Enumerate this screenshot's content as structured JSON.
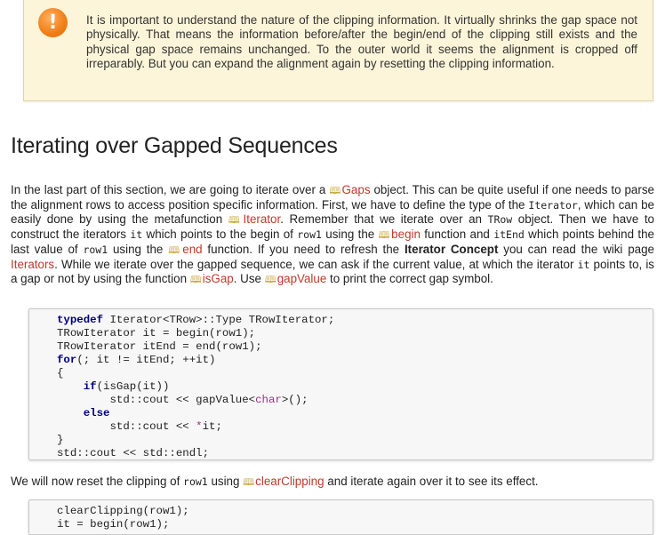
{
  "warning": {
    "icon": "exclamation-icon",
    "icon_glyph": "!",
    "text": "It is important to understand the nature of the clipping information. It virtually shrinks the gap space not physically. That means the information before/after the begin/end of the clipping still exists and the physical gap space remains unchanged. To the outer world it seems the alignment is cropped off irreparably. But you can expand the alignment again by resetting the clipping information."
  },
  "section": {
    "title": "Iterating over Gapped Sequences"
  },
  "para1": {
    "t1": "In the last part of this section, we are going to iterate over a ",
    "link_gaps": "Gaps",
    "t2": " object. This can be quite useful if one needs to parse the alignment rows to access position specific information. First, we have to define the type of the ",
    "code_iterator": "Iterator",
    "t3": ", which can be easily done by using the metafunction ",
    "link_iterator": "Iterator",
    "t4": ". Remember that we iterate over an ",
    "code_trow": "TRow",
    "t5": " object. Then we have to construct the iterators ",
    "code_it": "it",
    "t6": " which points to the begin of ",
    "code_row1": "row1",
    "t7": " using the ",
    "link_begin": "begin",
    "t8": " function and ",
    "code_itend": "itEnd",
    "t9": " which points behind the last value of ",
    "code_row1b": "row1",
    "t10": " using the ",
    "link_end": "end",
    "t11": " function. If you need to refresh the ",
    "bold_concept": "Iterator Concept",
    "t12": " you can read the wiki page ",
    "link_iterators": "Iterators",
    "t13": ". While we iterate over the gapped sequence, we can ask if the current value, at which the iterator ",
    "code_it2": "it",
    "t14": " points to, is a gap or not by using the function ",
    "link_isgap": "isGap",
    "t15": ". Use ",
    "link_gapvalue": "gapValue",
    "t16": " to print the correct gap symbol."
  },
  "code1": {
    "l1_kw": "typedef",
    "l1_rest": " Iterator<TRow>::Type TRowIterator;",
    "l2": "TRowIterator it = begin(row1);",
    "l3": "TRowIterator itEnd = end(row1);",
    "l4_kw": "for",
    "l4_rest": "(; it != itEnd; ++it)",
    "l5": "{",
    "l6_kw": "if",
    "l6_rest": "(isGap(it))",
    "l7_a": "std::cout << gapValue<",
    "l7_type": "char",
    "l7_b": ">();",
    "l8_kw": "else",
    "l9_a": "std::cout << ",
    "l9_star": "*",
    "l9_b": "it;",
    "l10": "}",
    "l11": "std::cout << std::endl;"
  },
  "para2": {
    "t1": "We will now reset the clipping of ",
    "code_row1": "row1",
    "t2": " using ",
    "link_clear": "clearClipping",
    "t3": " and iterate again over it to see its effect."
  },
  "code2": {
    "l1": "clearClipping(row1);",
    "l2": "it = begin(row1);"
  },
  "icons": {
    "doc_link": "book-icon",
    "book_glyph": "📖"
  },
  "colors": {
    "link": "#c0392b",
    "warning_bg": "#fcf5d9",
    "warning_icon": "#f07d16",
    "keyword": "#000080"
  }
}
